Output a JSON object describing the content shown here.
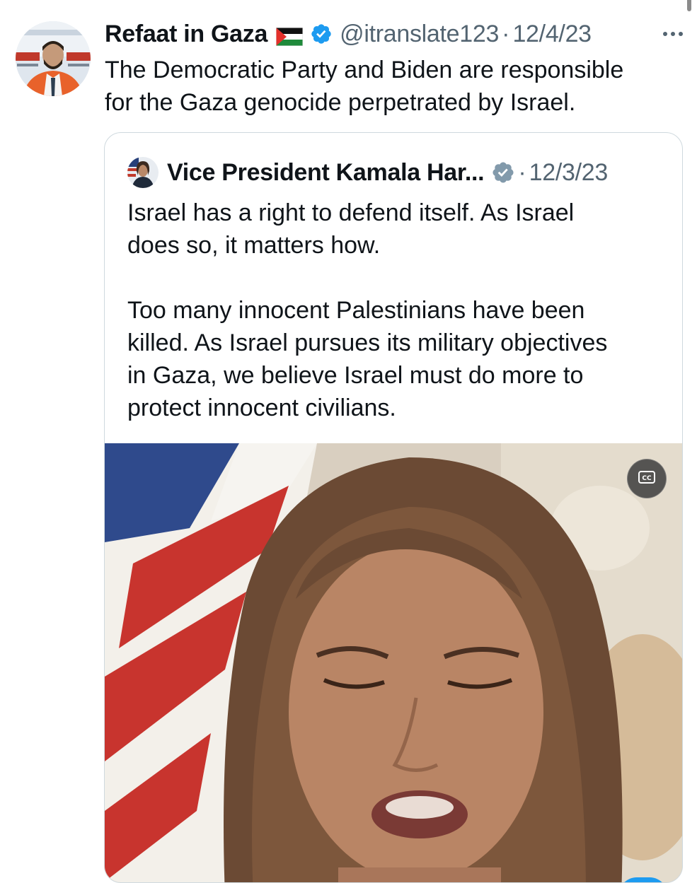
{
  "tweet": {
    "display_name": "Refaat in Gaza",
    "handle": "@itranslate123",
    "separator": "·",
    "date": "12/4/23",
    "more_label": "···",
    "text": "The Democratic Party and Biden are responsible\nfor the Gaza genocide perpetrated by Israel."
  },
  "quoted_tweet": {
    "display_name": "Vice President Kamala Har...",
    "separator": "·",
    "date": "12/3/23",
    "text": "Israel has a right to defend itself. As Israel\ndoes so, it matters how.\n\nToo many innocent Palestinians have been\nkilled. As Israel pursues its military objectives\nin Gaza, we believe Israel must do more to\nprotect innocent civilians.",
    "media": {
      "cc_label": "CC"
    }
  },
  "colors": {
    "text": "#0f1419",
    "secondary": "#536471",
    "verified_blue": "#1d9bf0",
    "verified_gray": "#829aab",
    "border": "#cfd9de"
  },
  "icons": {
    "flag": "palestine-flag-icon",
    "verified": "verified-badge-icon",
    "government_verified": "government-badge-icon",
    "more": "more-icon",
    "captions": "closed-captions-icon"
  }
}
